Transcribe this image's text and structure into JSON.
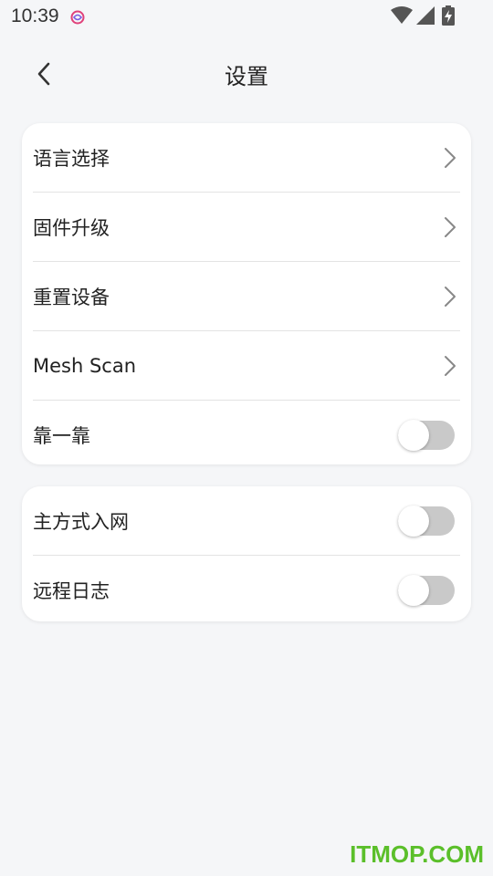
{
  "status_bar": {
    "time": "10:39",
    "icons": [
      "notification-app-icon",
      "wifi-icon",
      "signal-icon",
      "battery-charging-icon"
    ]
  },
  "header": {
    "title": "设置",
    "back_icon": "back-arrow-icon"
  },
  "group1": {
    "items": [
      {
        "label": "语言选择",
        "control": "chevron"
      },
      {
        "label": "固件升级",
        "control": "chevron"
      },
      {
        "label": "重置设备",
        "control": "chevron"
      },
      {
        "label": "Mesh Scan",
        "control": "chevron"
      },
      {
        "label": "靠一靠",
        "control": "toggle",
        "value": false
      }
    ]
  },
  "group2": {
    "items": [
      {
        "label": "主方式入网",
        "control": "toggle",
        "value": false
      },
      {
        "label": "远程日志",
        "control": "toggle",
        "value": false
      }
    ]
  },
  "colors": {
    "background": "#f5f6f8",
    "card": "#ffffff",
    "toggle_off": "#c9c9c9",
    "watermark": "#5bbf2a"
  },
  "watermark": "ITMOP.COM"
}
